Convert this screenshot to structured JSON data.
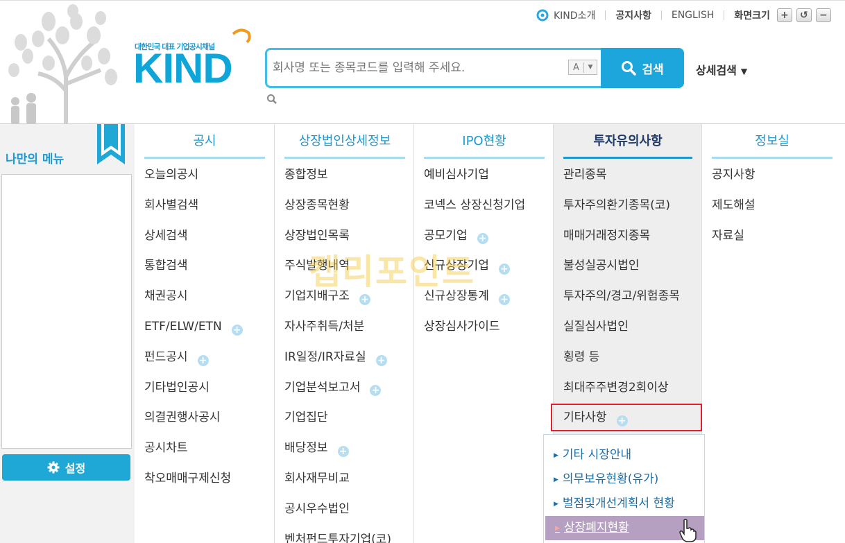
{
  "header": {
    "util_links": {
      "about": "KIND소개",
      "notice": "공지사항",
      "english": "ENGLISH",
      "zoom_label": "화면크기",
      "zoom_in": "+",
      "zoom_reset": "↺",
      "zoom_out": "−"
    },
    "logo": {
      "tagline": "대한민국 대표 기업공시채널",
      "text": "KIND"
    },
    "search": {
      "placeholder": "회사명 또는 종목코드를 입력해 주세요.",
      "font_letter": "A",
      "button_label": "검색",
      "detail_label": "상세검색"
    }
  },
  "left_panel": {
    "title": "나만의 메뉴",
    "settings_label": "설정"
  },
  "menu": {
    "columns": [
      {
        "title": "공시",
        "items": [
          "오늘의공시",
          "회사별검색",
          "상세검색",
          "통합검색",
          "채권공시",
          "ETF/ELW/ETN",
          "펀드공시",
          "기타법인공시",
          "의결권행사공시",
          "공시차트",
          "착오매매구제신청"
        ]
      },
      {
        "title": "상장법인상세정보",
        "items": [
          "종합정보",
          "상장종목현황",
          "상장법인목록",
          "주식발행내역",
          "기업지배구조",
          "자사주취득/처분",
          "IR일정/IR자료실",
          "기업분석보고서",
          "기업집단",
          "배당정보",
          "회사재무비교",
          "공시우수법인",
          "벤처펀드투자기업(코)"
        ]
      },
      {
        "title": "IPO현황",
        "items": [
          "예비심사기업",
          "코넥스 상장신청기업",
          "공모기업",
          "신규상장기업",
          "신규상장통계",
          "상장심사가이드"
        ]
      },
      {
        "title": "투자유의사항",
        "items": [
          "관리종목",
          "투자주의환기종목(코)",
          "매매거래정지종목",
          "불성실공시법인",
          "투자주의/경고/위험종목",
          "실질심사법인",
          "횡령 등",
          "최대주주변경2회이상",
          "기타사항"
        ]
      },
      {
        "title": "정보실",
        "items": [
          "공지사항",
          "제도해설",
          "자료실"
        ]
      }
    ],
    "submenu": {
      "items": [
        "기타 시장안내",
        "의무보유현황(유가)",
        "벌점및개선계획서 현황",
        "상장폐지현황"
      ]
    }
  },
  "watermark": "캡리포인트",
  "colors": {
    "accent": "#1da6db",
    "active_text": "#1f3b6a",
    "highlight": "#e2202b",
    "hover": "#b6a0c1"
  }
}
